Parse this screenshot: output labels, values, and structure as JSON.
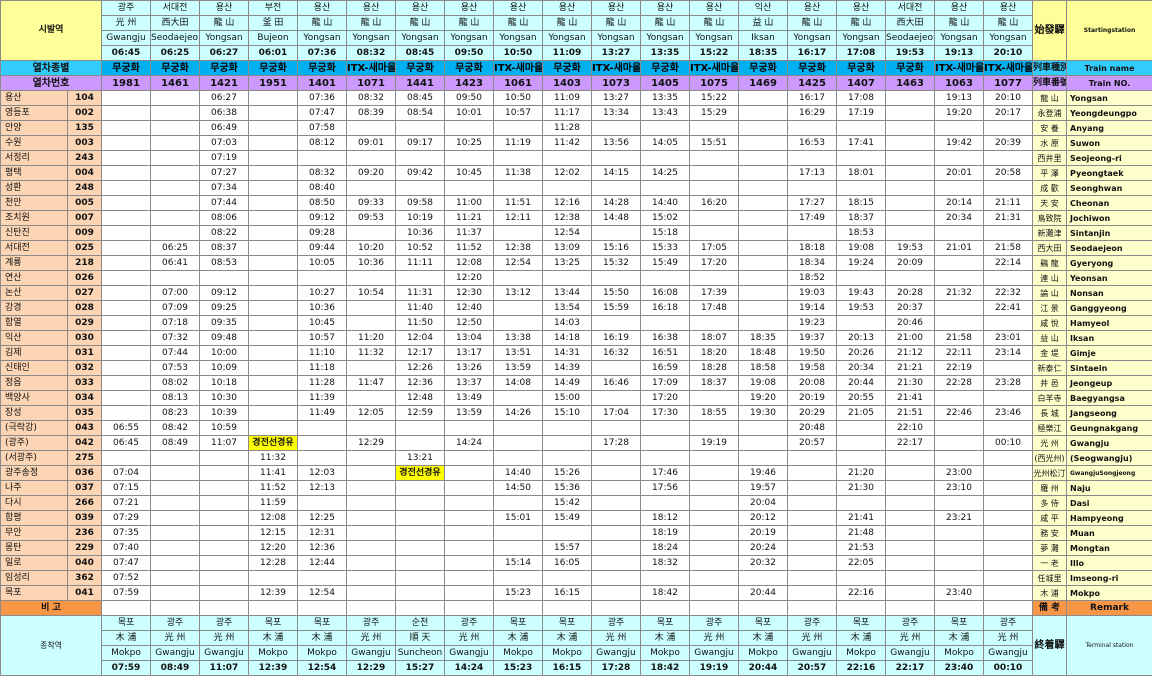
{
  "header": {
    "origin_label": "시발역",
    "origin_hanja": "始發驛",
    "origin_eng": "Startingstation",
    "type_label": "열차종별",
    "type_hanja": "列車種別",
    "type_eng": "Train name",
    "number_label": "열차번호",
    "number_hanja": "列車番號",
    "number_eng": "Train NO."
  },
  "trains": [
    {
      "from_ko": "광주",
      "from_hanja": "光 州",
      "from_en": "Gwangju",
      "dep": "06:45",
      "type": "무궁화",
      "no": "1981",
      "to_ko": "목포",
      "to_hanja": "木 浦",
      "to_en": "Mokpo",
      "arr": "07:59"
    },
    {
      "from_ko": "서대전",
      "from_hanja": "西大田",
      "from_en": "Seodaejeon",
      "dep": "06:25",
      "type": "무궁화",
      "no": "1461",
      "to_ko": "광주",
      "to_hanja": "光 州",
      "to_en": "Gwangju",
      "arr": "08:49"
    },
    {
      "from_ko": "용산",
      "from_hanja": "龍 山",
      "from_en": "Yongsan",
      "dep": "06:27",
      "type": "무궁화",
      "no": "1421",
      "to_ko": "광주",
      "to_hanja": "光 州",
      "to_en": "Gwangju",
      "arr": "11:07"
    },
    {
      "from_ko": "부전",
      "from_hanja": "釜 田",
      "from_en": "Bujeon",
      "dep": "06:01",
      "type": "무궁화",
      "no": "1951",
      "to_ko": "목포",
      "to_hanja": "木 浦",
      "to_en": "Mokpo",
      "arr": "12:39"
    },
    {
      "from_ko": "용산",
      "from_hanja": "龍 山",
      "from_en": "Yongsan",
      "dep": "07:36",
      "type": "무궁화",
      "no": "1401",
      "to_ko": "목포",
      "to_hanja": "木 浦",
      "to_en": "Mokpo",
      "arr": "12:54"
    },
    {
      "from_ko": "용산",
      "from_hanja": "龍 山",
      "from_en": "Yongsan",
      "dep": "08:32",
      "type": "ITX-새마을",
      "no": "1071",
      "to_ko": "광주",
      "to_hanja": "光 州",
      "to_en": "Gwangju",
      "arr": "12:29"
    },
    {
      "from_ko": "용산",
      "from_hanja": "龍 山",
      "from_en": "Yongsan",
      "dep": "08:45",
      "type": "무궁화",
      "no": "1441",
      "to_ko": "순천",
      "to_hanja": "順 天",
      "to_en": "Suncheon",
      "arr": "15:27"
    },
    {
      "from_ko": "용산",
      "from_hanja": "龍 山",
      "from_en": "Yongsan",
      "dep": "09:50",
      "type": "무궁화",
      "no": "1423",
      "to_ko": "광주",
      "to_hanja": "光 州",
      "to_en": "Gwangju",
      "arr": "14:24"
    },
    {
      "from_ko": "용산",
      "from_hanja": "龍 山",
      "from_en": "Yongsan",
      "dep": "10:50",
      "type": "ITX-새마을",
      "no": "1061",
      "to_ko": "목포",
      "to_hanja": "木 浦",
      "to_en": "Mokpo",
      "arr": "15:23"
    },
    {
      "from_ko": "용산",
      "from_hanja": "龍 山",
      "from_en": "Yongsan",
      "dep": "11:09",
      "type": "무궁화",
      "no": "1403",
      "to_ko": "목포",
      "to_hanja": "木 浦",
      "to_en": "Mokpo",
      "arr": "16:15"
    },
    {
      "from_ko": "용산",
      "from_hanja": "龍 山",
      "from_en": "Yongsan",
      "dep": "13:27",
      "type": "ITX-새마을",
      "no": "1073",
      "to_ko": "광주",
      "to_hanja": "光 州",
      "to_en": "Gwangju",
      "arr": "17:28"
    },
    {
      "from_ko": "용산",
      "from_hanja": "龍 山",
      "from_en": "Yongsan",
      "dep": "13:35",
      "type": "무궁화",
      "no": "1405",
      "to_ko": "목포",
      "to_hanja": "木 浦",
      "to_en": "Mokpo",
      "arr": "18:42"
    },
    {
      "from_ko": "용산",
      "from_hanja": "龍 山",
      "from_en": "Yongsan",
      "dep": "15:22",
      "type": "ITX-새마을",
      "no": "1075",
      "to_ko": "광주",
      "to_hanja": "光 州",
      "to_en": "Gwangju",
      "arr": "19:19"
    },
    {
      "from_ko": "익산",
      "from_hanja": "益 山",
      "from_en": "Iksan",
      "dep": "18:35",
      "type": "무궁화",
      "no": "1469",
      "to_ko": "목포",
      "to_hanja": "木 浦",
      "to_en": "Mokpo",
      "arr": "20:44"
    },
    {
      "from_ko": "용산",
      "from_hanja": "龍 山",
      "from_en": "Yongsan",
      "dep": "16:17",
      "type": "무궁화",
      "no": "1425",
      "to_ko": "광주",
      "to_hanja": "光 州",
      "to_en": "Gwangju",
      "arr": "20:57"
    },
    {
      "from_ko": "용산",
      "from_hanja": "龍 山",
      "from_en": "Yongsan",
      "dep": "17:08",
      "type": "무궁화",
      "no": "1407",
      "to_ko": "목포",
      "to_hanja": "木 浦",
      "to_en": "Mokpo",
      "arr": "22:16"
    },
    {
      "from_ko": "서대전",
      "from_hanja": "西大田",
      "from_en": "Seodaejeon",
      "dep": "19:53",
      "type": "무궁화",
      "no": "1463",
      "to_ko": "광주",
      "to_hanja": "光 州",
      "to_en": "Gwangju",
      "arr": "22:17"
    },
    {
      "from_ko": "용산",
      "from_hanja": "龍 山",
      "from_en": "Yongsan",
      "dep": "19:13",
      "type": "ITX-새마을",
      "no": "1063",
      "to_ko": "목포",
      "to_hanja": "木 浦",
      "to_en": "Mokpo",
      "arr": "23:40"
    },
    {
      "from_ko": "용산",
      "from_hanja": "龍 山",
      "from_en": "Yongsan",
      "dep": "20:10",
      "type": "ITX-새마을",
      "no": "1077",
      "to_ko": "광주",
      "to_hanja": "光 州",
      "to_en": "Gwangju",
      "arr": "00:10"
    }
  ],
  "stations": [
    {
      "ko": "용산",
      "code": "104",
      "hanja": "龍 山",
      "en": "Yongsan",
      "times": [
        "",
        "",
        "06:27",
        "",
        "07:36",
        "08:32",
        "08:45",
        "09:50",
        "10:50",
        "11:09",
        "13:27",
        "13:35",
        "15:22",
        "",
        "16:17",
        "17:08",
        "",
        "19:13",
        "20:10"
      ]
    },
    {
      "ko": "영등포",
      "code": "002",
      "hanja": "永登浦",
      "en": "Yeongdeungpo",
      "times": [
        "",
        "",
        "06:38",
        "",
        "07:47",
        "08:39",
        "08:54",
        "10:01",
        "10:57",
        "11:17",
        "13:34",
        "13:43",
        "15:29",
        "",
        "16:29",
        "17:19",
        "",
        "19:20",
        "20:17"
      ]
    },
    {
      "ko": "안양",
      "code": "135",
      "hanja": "安 養",
      "en": "Anyang",
      "times": [
        "",
        "",
        "06:49",
        "",
        "07:58",
        "",
        "",
        "",
        "",
        "11:28",
        "",
        "",
        "",
        "",
        "",
        "",
        "",
        "",
        ""
      ]
    },
    {
      "ko": "수원",
      "code": "003",
      "hanja": "水 原",
      "en": "Suwon",
      "times": [
        "",
        "",
        "07:03",
        "",
        "08:12",
        "09:01",
        "09:17",
        "10:25",
        "11:19",
        "11:42",
        "13:56",
        "14:05",
        "15:51",
        "",
        "16:53",
        "17:41",
        "",
        "19:42",
        "20:39"
      ]
    },
    {
      "ko": "서정리",
      "code": "243",
      "hanja": "西井里",
      "en": "Seojeong-ri",
      "times": [
        "",
        "",
        "07:19",
        "",
        "",
        "",
        "",
        "",
        "",
        "",
        "",
        "",
        "",
        "",
        "",
        "",
        "",
        "",
        ""
      ]
    },
    {
      "ko": "평택",
      "code": "004",
      "hanja": "平 澤",
      "en": "Pyeongtaek",
      "times": [
        "",
        "",
        "07:27",
        "",
        "08:32",
        "09:20",
        "09:42",
        "10:45",
        "11:38",
        "12:02",
        "14:15",
        "14:25",
        "",
        "",
        "17:13",
        "18:01",
        "",
        "20:01",
        "20:58"
      ]
    },
    {
      "ko": "성환",
      "code": "248",
      "hanja": "成 歡",
      "en": "Seonghwan",
      "times": [
        "",
        "",
        "07:34",
        "",
        "08:40",
        "",
        "",
        "",
        "",
        "",
        "",
        "",
        "",
        "",
        "",
        "",
        "",
        "",
        ""
      ]
    },
    {
      "ko": "천안",
      "code": "005",
      "hanja": "天 安",
      "en": "Cheonan",
      "times": [
        "",
        "",
        "07:44",
        "",
        "08:50",
        "09:33",
        "09:58",
        "11:00",
        "11:51",
        "12:16",
        "14:28",
        "14:40",
        "16:20",
        "",
        "17:27",
        "18:15",
        "",
        "20:14",
        "21:11"
      ]
    },
    {
      "ko": "조치원",
      "code": "007",
      "hanja": "鳥致院",
      "en": "Jochiwon",
      "times": [
        "",
        "",
        "08:06",
        "",
        "09:12",
        "09:53",
        "10:19",
        "11:21",
        "12:11",
        "12:38",
        "14:48",
        "15:02",
        "",
        "",
        "17:49",
        "18:37",
        "",
        "20:34",
        "21:31"
      ]
    },
    {
      "ko": "신탄진",
      "code": "009",
      "hanja": "新灘津",
      "en": "Sintanjin",
      "times": [
        "",
        "",
        "08:22",
        "",
        "09:28",
        "",
        "10:36",
        "11:37",
        "",
        "12:54",
        "",
        "15:18",
        "",
        "",
        "",
        "18:53",
        "",
        "",
        ""
      ]
    },
    {
      "ko": "서대전",
      "code": "025",
      "hanja": "西大田",
      "en": "Seodaejeon",
      "times": [
        "",
        "06:25",
        "08:37",
        "",
        "09:44",
        "10:20",
        "10:52",
        "11:52",
        "12:38",
        "13:09",
        "15:16",
        "15:33",
        "17:05",
        "",
        "18:18",
        "19:08",
        "19:53",
        "21:01",
        "21:58"
      ]
    },
    {
      "ko": "계룡",
      "code": "218",
      "hanja": "鷄 龍",
      "en": "Gyeryong",
      "times": [
        "",
        "06:41",
        "08:53",
        "",
        "10:05",
        "10:36",
        "11:11",
        "12:08",
        "12:54",
        "13:25",
        "15:32",
        "15:49",
        "17:20",
        "",
        "18:34",
        "19:24",
        "20:09",
        "",
        "22:14"
      ]
    },
    {
      "ko": "연산",
      "code": "026",
      "hanja": "連 山",
      "en": "Yeonsan",
      "times": [
        "",
        "",
        "",
        "",
        "",
        "",
        "",
        "12:20",
        "",
        "",
        "",
        "",
        "",
        "",
        "18:52",
        "",
        "",
        "",
        ""
      ]
    },
    {
      "ko": "논산",
      "code": "027",
      "hanja": "論 山",
      "en": "Nonsan",
      "times": [
        "",
        "07:00",
        "09:12",
        "",
        "10:27",
        "10:54",
        "11:31",
        "12:30",
        "13:12",
        "13:44",
        "15:50",
        "16:08",
        "17:39",
        "",
        "19:03",
        "19:43",
        "20:28",
        "21:32",
        "22:32"
      ]
    },
    {
      "ko": "강경",
      "code": "028",
      "hanja": "江 景",
      "en": "Ganggyeong",
      "times": [
        "",
        "07:09",
        "09:25",
        "",
        "10:36",
        "",
        "11:40",
        "12:40",
        "",
        "13:54",
        "15:59",
        "16:18",
        "17:48",
        "",
        "19:14",
        "19:53",
        "20:37",
        "",
        "22:41"
      ]
    },
    {
      "ko": "함열",
      "code": "029",
      "hanja": "咸 悅",
      "en": "Hamyeol",
      "times": [
        "",
        "07:18",
        "09:35",
        "",
        "10:45",
        "",
        "11:50",
        "12:50",
        "",
        "14:03",
        "",
        "",
        "",
        "",
        "19:23",
        "",
        "20:46",
        "",
        ""
      ]
    },
    {
      "ko": "익산",
      "code": "030",
      "hanja": "益 山",
      "en": "Iksan",
      "times": [
        "",
        "07:32",
        "09:48",
        "",
        "10:57",
        "11:20",
        "12:04",
        "13:04",
        "13:38",
        "14:18",
        "16:19",
        "16:38",
        "18:07",
        "18:35",
        "19:37",
        "20:13",
        "21:00",
        "21:58",
        "23:01"
      ]
    },
    {
      "ko": "김제",
      "code": "031",
      "hanja": "金 堤",
      "en": "Gimje",
      "times": [
        "",
        "07:44",
        "10:00",
        "",
        "11:10",
        "11:32",
        "12:17",
        "13:17",
        "13:51",
        "14:31",
        "16:32",
        "16:51",
        "18:20",
        "18:48",
        "19:50",
        "20:26",
        "21:12",
        "22:11",
        "23:14"
      ]
    },
    {
      "ko": "신태인",
      "code": "032",
      "hanja": "新泰仁",
      "en": "Sintaein",
      "times": [
        "",
        "07:53",
        "10:09",
        "",
        "11:18",
        "",
        "12:26",
        "13:26",
        "13:59",
        "14:39",
        "",
        "16:59",
        "18:28",
        "18:58",
        "19:58",
        "20:34",
        "21:21",
        "22:19",
        ""
      ]
    },
    {
      "ko": "정읍",
      "code": "033",
      "hanja": "井 邑",
      "en": "Jeongeup",
      "times": [
        "",
        "08:02",
        "10:18",
        "",
        "11:28",
        "11:47",
        "12:36",
        "13:37",
        "14:08",
        "14:49",
        "16:46",
        "17:09",
        "18:37",
        "19:08",
        "20:08",
        "20:44",
        "21:30",
        "22:28",
        "23:28"
      ]
    },
    {
      "ko": "백양사",
      "code": "034",
      "hanja": "白羊寺",
      "en": "Baegyangsa",
      "times": [
        "",
        "08:13",
        "10:30",
        "",
        "11:39",
        "",
        "12:48",
        "13:49",
        "",
        "15:00",
        "",
        "17:20",
        "",
        "19:20",
        "20:19",
        "20:55",
        "21:41",
        "",
        ""
      ]
    },
    {
      "ko": "장성",
      "code": "035",
      "hanja": "長 城",
      "en": "Jangseong",
      "times": [
        "",
        "08:23",
        "10:39",
        "",
        "11:49",
        "12:05",
        "12:59",
        "13:59",
        "14:26",
        "15:10",
        "17:04",
        "17:30",
        "18:55",
        "19:30",
        "20:29",
        "21:05",
        "21:51",
        "22:46",
        "23:46"
      ]
    },
    {
      "ko": "(극락강)",
      "code": "043",
      "hanja": "極樂江",
      "en": "Geungnakgang",
      "times": [
        "06:55",
        "08:42",
        "10:59",
        "",
        "",
        "",
        "",
        "",
        "",
        "",
        "",
        "",
        "",
        "",
        "20:48",
        "",
        "22:10",
        "",
        ""
      ]
    },
    {
      "ko": "(광주)",
      "code": "042",
      "hanja": "光 州",
      "en": "Gwangju",
      "times": [
        "06:45",
        "08:49",
        "11:07",
        "경전선경유",
        "",
        "12:29",
        "",
        "14:24",
        "",
        "",
        "17:28",
        "",
        "19:19",
        "",
        "20:57",
        "",
        "22:17",
        "",
        "00:10"
      ]
    },
    {
      "ko": "(서광주)",
      "code": "275",
      "hanja": "(西光州)",
      "en": "(Seogwangju)",
      "times": [
        "",
        "",
        "",
        "11:32",
        "",
        "",
        "13:21",
        "",
        "",
        "",
        "",
        "",
        "",
        "",
        "",
        "",
        "",
        "",
        ""
      ]
    },
    {
      "ko": "광주송정",
      "code": "036",
      "hanja": "光州松汀",
      "en": "GwangjuSongjeong",
      "times": [
        "07:04",
        "",
        "",
        "11:41",
        "12:03",
        "",
        "경전선경유",
        "",
        "14:40",
        "15:26",
        "",
        "17:46",
        "",
        "19:46",
        "",
        "21:20",
        "",
        "23:00",
        ""
      ]
    },
    {
      "ko": "나주",
      "code": "037",
      "hanja": "羅 州",
      "en": "Naju",
      "times": [
        "07:15",
        "",
        "",
        "11:52",
        "12:13",
        "",
        "",
        "",
        "14:50",
        "15:36",
        "",
        "17:56",
        "",
        "19:57",
        "",
        "21:30",
        "",
        "23:10",
        ""
      ]
    },
    {
      "ko": "다시",
      "code": "266",
      "hanja": "多 侍",
      "en": "Dasi",
      "times": [
        "07:21",
        "",
        "",
        "11:59",
        "",
        "",
        "",
        "",
        "",
        "15:42",
        "",
        "",
        "",
        "20:04",
        "",
        "",
        "",
        "",
        ""
      ]
    },
    {
      "ko": "함평",
      "code": "039",
      "hanja": "咸 平",
      "en": "Hampyeong",
      "times": [
        "07:29",
        "",
        "",
        "12:08",
        "12:25",
        "",
        "",
        "",
        "15:01",
        "15:49",
        "",
        "18:12",
        "",
        "20:12",
        "",
        "21:41",
        "",
        "23:21",
        ""
      ]
    },
    {
      "ko": "무안",
      "code": "236",
      "hanja": "務 安",
      "en": "Muan",
      "times": [
        "07:35",
        "",
        "",
        "12:15",
        "12:31",
        "",
        "",
        "",
        "",
        "",
        "",
        "18:19",
        "",
        "20:19",
        "",
        "21:48",
        "",
        "",
        ""
      ]
    },
    {
      "ko": "몽탄",
      "code": "229",
      "hanja": "夢 灘",
      "en": "Mongtan",
      "times": [
        "07:40",
        "",
        "",
        "12:20",
        "12:36",
        "",
        "",
        "",
        "",
        "15:57",
        "",
        "18:24",
        "",
        "20:24",
        "",
        "21:53",
        "",
        "",
        ""
      ]
    },
    {
      "ko": "일로",
      "code": "040",
      "hanja": "一 老",
      "en": "Illo",
      "times": [
        "07:47",
        "",
        "",
        "12:28",
        "12:44",
        "",
        "",
        "",
        "15:14",
        "16:05",
        "",
        "18:32",
        "",
        "20:32",
        "",
        "22:05",
        "",
        "",
        ""
      ]
    },
    {
      "ko": "임성리",
      "code": "362",
      "hanja": "任城里",
      "en": "Imseong-ri",
      "times": [
        "07:52",
        "",
        "",
        "",
        "",
        "",
        "",
        "",
        "",
        "",
        "",
        "",
        "",
        "",
        "",
        "",
        "",
        "",
        ""
      ]
    },
    {
      "ko": "목포",
      "code": "041",
      "hanja": "木 浦",
      "en": "Mokpo",
      "times": [
        "07:59",
        "",
        "",
        "12:39",
        "12:54",
        "",
        "",
        "",
        "15:23",
        "16:15",
        "",
        "18:42",
        "",
        "20:44",
        "",
        "22:16",
        "",
        "23:40",
        ""
      ]
    }
  ],
  "remark": {
    "label": "비 고",
    "hanja": "備 考",
    "en": "Remark"
  },
  "footer": {
    "terminal_label": "종착역",
    "terminal_hanja": "終着驛",
    "terminal_eng": "Terminal station"
  }
}
